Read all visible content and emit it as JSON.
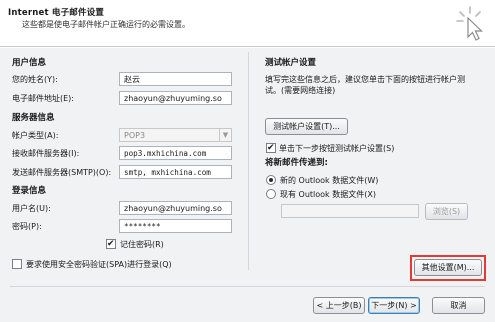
{
  "header": {
    "title": "Internet 电子邮件设置",
    "subtitle": "这些都是使电子邮件帐户正确运行的必需设置。",
    "icon": "cursor-click-icon"
  },
  "user_info": {
    "heading": "用户信息",
    "name_label": "您的姓名(Y):",
    "name_value": "赵云",
    "email_label": "电子邮件地址(E):",
    "email_value": "zhaoyun@zhuyuming.so"
  },
  "server_info": {
    "heading": "服务器信息",
    "account_type_label": "帐户类型(A):",
    "account_type_value": "POP3",
    "incoming_label": "接收邮件服务器(I):",
    "incoming_value": "pop3.mxhichina.com",
    "outgoing_label": "发送邮件服务器(SMTP)(O):",
    "outgoing_value": "smtp, mxhichina.com"
  },
  "login_info": {
    "heading": "登录信息",
    "username_label": "用户名(U):",
    "username_value": "zhaoyun@zhuyuming.so",
    "password_label": "密码(P):",
    "password_value": "********",
    "remember_label": "记住密码(R)",
    "remember_checked": true,
    "spa_label": "要求使用安全密码验证(SPA)进行登录(Q)",
    "spa_checked": false
  },
  "test_settings": {
    "heading": "测试帐户设置",
    "description": "填写完这些信息之后，建议您单击下面的按钮进行帐户测试。(需要网络连接)",
    "test_button": "测试帐户设置(T)...",
    "auto_test_label": "单击下一步按钮测试帐户设置(S)",
    "auto_test_checked": true
  },
  "deliver": {
    "heading": "将新邮件传递到:",
    "new_file_label": "新的 Outlook 数据文件(W)",
    "existing_file_label": "现有 Outlook 数据文件(X)",
    "selected": "new",
    "existing_path_value": "",
    "browse_button": "浏览(S)"
  },
  "more_settings_button": "其他设置(M)...",
  "footer": {
    "back_button": "< 上一步(B)",
    "next_button": "下一步(N) >",
    "cancel_button": "取消"
  },
  "colors": {
    "highlight_border": "#e53935",
    "panel_bg": "#f1f2f4"
  }
}
